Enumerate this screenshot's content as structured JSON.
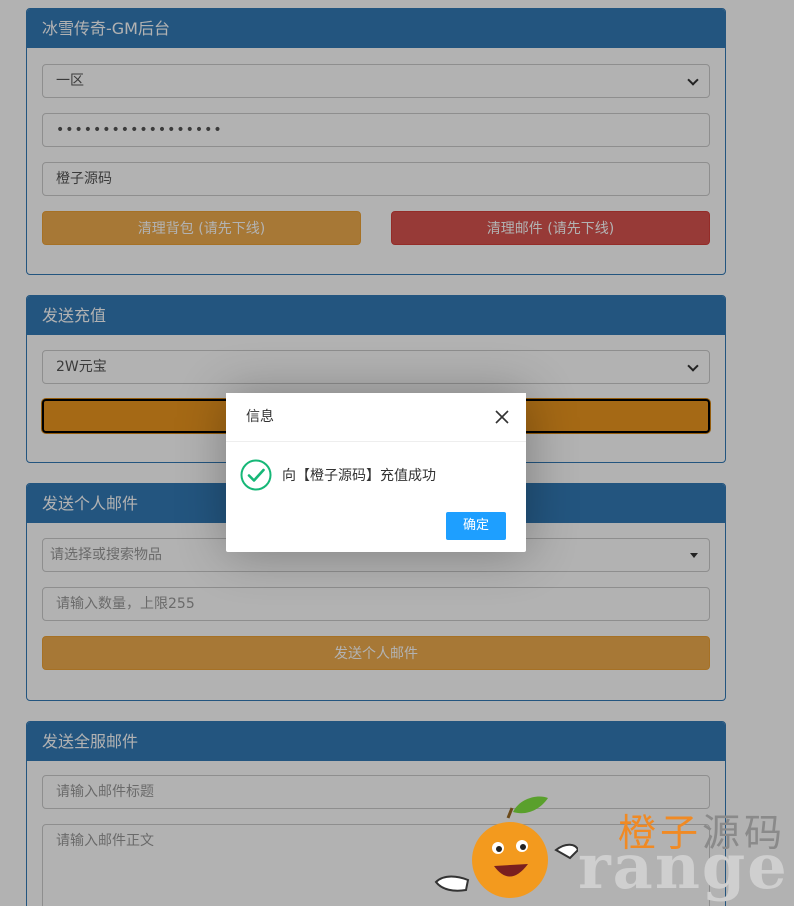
{
  "panel1": {
    "title": "冰雪传奇-GM后台",
    "server_select": "一区",
    "password_field": "••••••••••••••••••",
    "name_field": "橙子源码",
    "btn_clear_bag": "清理背包 (请先下线)",
    "btn_clear_mail": "清理邮件 (请先下线)"
  },
  "panel2": {
    "title": "发送充值",
    "amount_select": "2W元宝"
  },
  "panel3": {
    "title": "发送个人邮件",
    "item_search_placeholder": "请选择或搜索物品",
    "quantity_placeholder": "请输入数量，上限255",
    "btn_send_personal": "发送个人邮件"
  },
  "panel4": {
    "title": "发送全服邮件",
    "mail_title_placeholder": "请输入邮件标题",
    "mail_body_placeholder": "请输入邮件正文"
  },
  "dialog": {
    "title": "信息",
    "message": "向【橙子源码】充值成功",
    "confirm": "确定"
  },
  "watermark": {
    "cn_part1": "橙子",
    "cn_part2": "源码",
    "en": "range"
  },
  "colors": {
    "primary": "#337ab7",
    "warning": "#f0ad4e",
    "danger": "#d9534f",
    "dialog_button": "#1E9FFF",
    "success_check": "#16b777"
  }
}
